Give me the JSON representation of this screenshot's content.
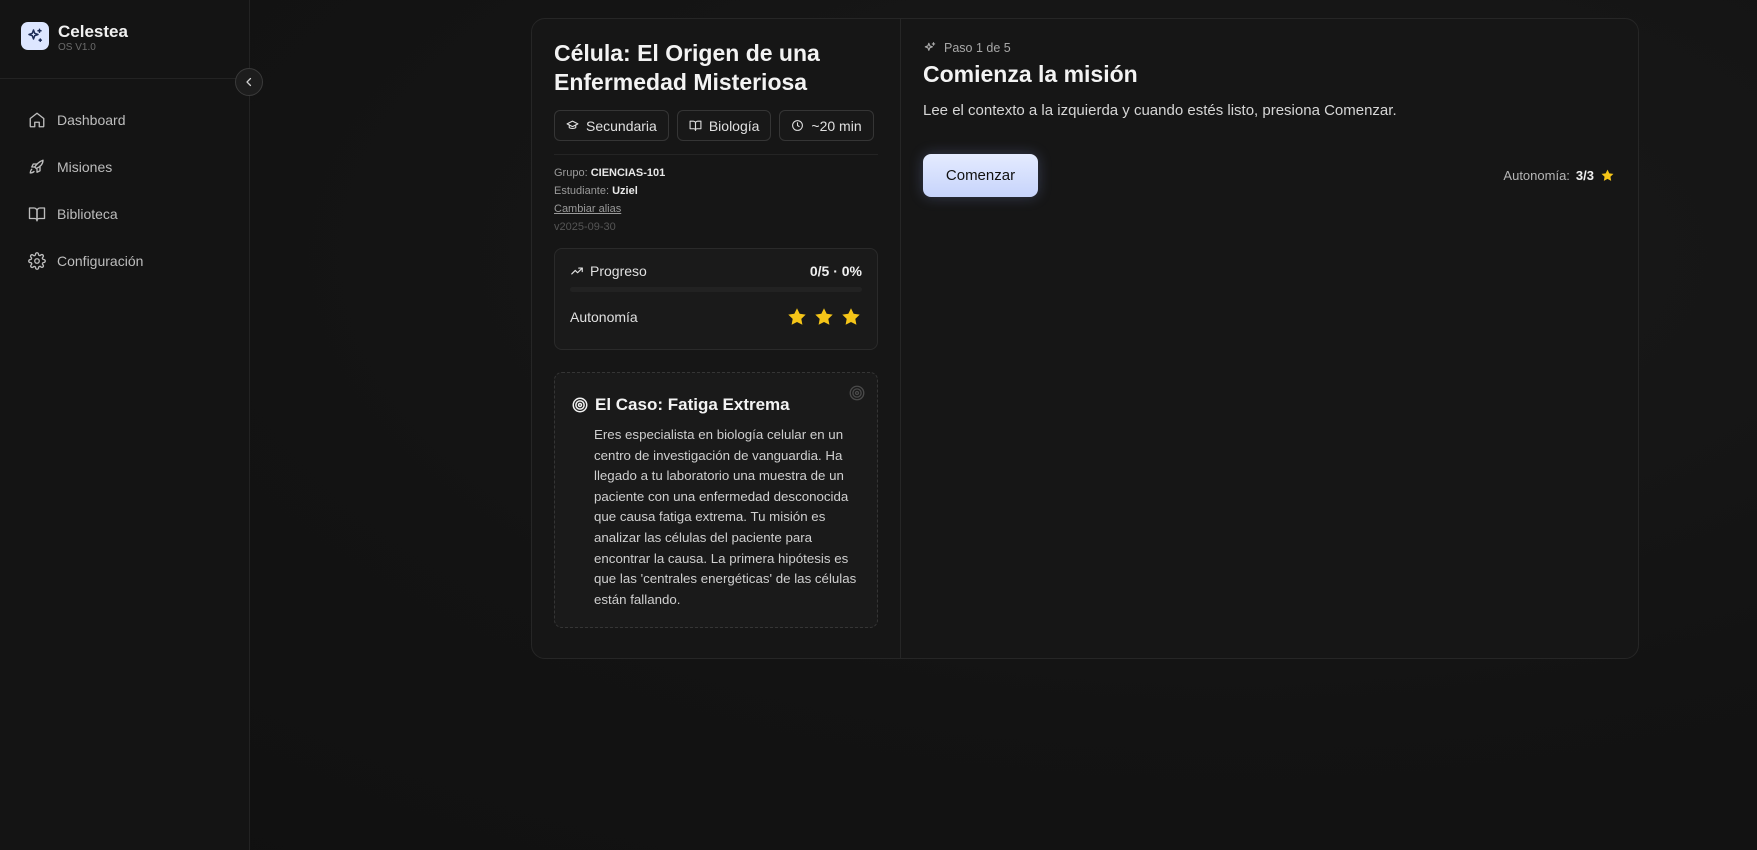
{
  "brand": {
    "name": "Celestea",
    "version": "OS V1.0"
  },
  "nav": {
    "items": [
      {
        "label": "Dashboard",
        "icon": "home-icon"
      },
      {
        "label": "Misiones",
        "icon": "rocket-icon"
      },
      {
        "label": "Biblioteca",
        "icon": "book-icon"
      },
      {
        "label": "Configuración",
        "icon": "gear-icon"
      }
    ]
  },
  "mission": {
    "title": "Célula: El Origen de una Enfermedad Misteriosa",
    "chips": [
      {
        "label": "Secundaria",
        "icon": "graduation-cap-icon"
      },
      {
        "label": "Biología",
        "icon": "book-open-icon"
      },
      {
        "label": "~20 min",
        "icon": "clock-icon"
      }
    ],
    "group_label": "Grupo:",
    "group_value": "CIENCIAS-101",
    "student_label": "Estudiante:",
    "student_value": "Uziel",
    "change_alias": "Cambiar alias",
    "version": "v2025-09-30"
  },
  "progress": {
    "label": "Progreso",
    "value": "0/5 · 0%",
    "percent": 0,
    "autonomy_label": "Autonomía",
    "stars": 3,
    "stars_max": 3
  },
  "case": {
    "title": "El Caso: Fatiga Extrema",
    "text": "Eres especialista en biología celular en un centro de investigación de vanguardia. Ha llegado a tu laboratorio una muestra de un paciente con una enfermedad desconocida que causa fatiga extrema. Tu misión es analizar las células del paciente para encontrar la causa. La primera hipótesis es que las 'centrales energéticas' de las células están fallando."
  },
  "step": {
    "label": "Paso 1 de 5",
    "title": "Comienza la misión",
    "description": "Lee el contexto a la izquierda y cuando estés listo, presiona Comenzar.",
    "start_button": "Comenzar",
    "autonomy_label": "Autonomía:",
    "autonomy_value": "3/3"
  },
  "colors": {
    "accent": "#c7d4fb",
    "star": "#f5c518"
  }
}
